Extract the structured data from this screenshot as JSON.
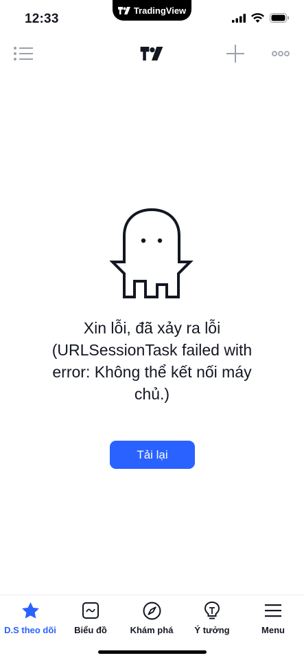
{
  "status_bar": {
    "time": "12:33",
    "island_app": "TradingView"
  },
  "top_nav": {
    "list_icon": "list-icon",
    "logo": "tradingview-logo",
    "add_icon": "plus-icon",
    "more_icon": "more-dots-icon"
  },
  "error": {
    "illustration": "ghost-icon",
    "message": "Xin lỗi, đã xảy ra lỗi (URLSessionTask failed with error: Không thể kết nối máy chủ.)",
    "reload_label": "Tải lại"
  },
  "tab_bar": {
    "tabs": [
      {
        "label": "D.S theo dõi",
        "icon": "star-icon",
        "active": true
      },
      {
        "label": "Biểu đồ",
        "icon": "chart-icon",
        "active": false
      },
      {
        "label": "Khám phá",
        "icon": "compass-icon",
        "active": false
      },
      {
        "label": "Ý tưởng",
        "icon": "lightbulb-icon",
        "active": false
      },
      {
        "label": "Menu",
        "icon": "menu-icon",
        "active": false
      }
    ]
  },
  "colors": {
    "accent": "#2962ff",
    "text": "#131722",
    "icon_gray": "#9ba0ab"
  }
}
